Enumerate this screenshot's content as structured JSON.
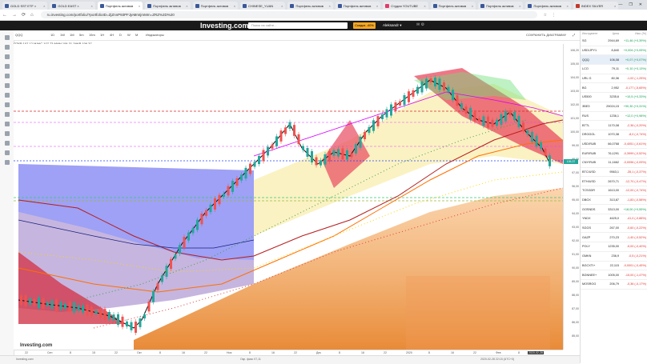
{
  "browser": {
    "tabs": [
      "GOLD SST ETF ×",
      "GOLD EAST ×",
      "Портфель активов",
      "Портфель активов",
      "Портфель активов",
      "CHINESE_YUAN",
      "Портфель активов",
      "Портфель активов",
      "Студия YOUTUBE",
      "Портфель активов",
      "Портфель активов",
      "Портфель активов",
      "INDEX SILVER"
    ],
    "tab_close": "×",
    "url": "ru.investing.com/portfolio/?portfolioID=ZjZnnP93PFJjeMmtjmMm=ZRZ%2D%20",
    "window": {
      "minimize": "—",
      "maximize": "❐",
      "close": "✕"
    },
    "nav": {
      "back": "←",
      "forward": "→",
      "reload": "⟳",
      "home": "⌂"
    },
    "ext_icons": [
      "☆",
      "⋮"
    ]
  },
  "site": {
    "logo": "Investing.com",
    "search_placeholder": "Поиск на сайте...",
    "promo": "Скидка -40%",
    "profile": "Aleksandr ▾",
    "header_icons": "✉ ⚙"
  },
  "chart": {
    "symbol": "QQQ",
    "toolbar": [
      "1D",
      "1W",
      "1M",
      "5m",
      "15m",
      "1H",
      "4H",
      "D",
      "W",
      "M",
      "Индикаторы",
      "⤢"
    ],
    "ohlc": "ОТКР 107,12   МАКС 107,73   МИН 106,31   ЗАКР 106,37",
    "save_label": "СОХРАНИТЬ ДИАГРАММУ",
    "price_labels": [
      "106,20",
      "105,00",
      "104,00",
      "103,00",
      "102,00",
      "101,00",
      "100,00",
      "99,00",
      "98,00",
      "97,00",
      "96,00",
      "95,00",
      "94,00",
      "93,00",
      "92,00",
      "91,00",
      "90,00",
      "89,00",
      "88,00",
      "87,00",
      "86,00",
      "85,00"
    ],
    "last_price": "106,37",
    "date_labels": [
      "22",
      "Сен",
      "8",
      "15",
      "22",
      "Окт",
      "8",
      "16",
      "22",
      "Ноя",
      "8",
      "16",
      "22",
      "Дек",
      "8",
      "16",
      "22",
      "2020",
      "8",
      "16",
      "22",
      "Фев",
      "8",
      "16"
    ],
    "crosshair_date": "2020-02-28",
    "watermark": "Investing.com"
  },
  "watchlist": {
    "headers": [
      "Инструмент",
      "Цена",
      "Изм. (%)"
    ],
    "rows": [
      {
        "sym": "SG",
        "price": "2944,69",
        "chg": "+11,46 (+0,39%)",
        "dir": "pos"
      },
      {
        "sym": "USD/JPY1",
        "price": "8,840",
        "chg": "+0,004 (+0,05%)",
        "dir": "pos"
      },
      {
        "sym": "QQQ",
        "price": "106,08",
        "chg": "+0,07 (+0,07%)",
        "dir": "pos"
      },
      {
        "sym": "LCO",
        "price": "79,11",
        "chg": "+0,10 (+0,13%)",
        "dir": "pos"
      },
      {
        "sym": "URL G",
        "price": "80,36",
        "chg": "-1,02 (-1,25%)",
        "dir": "neg"
      },
      {
        "sym": "BG",
        "price": "2,952",
        "chg": "-0,177 (-5,65%)",
        "dir": "neg"
      },
      {
        "sym": "US500",
        "price": "3235,6",
        "chg": "+10,5 (+0,33%)",
        "dir": "pos"
      },
      {
        "sym": "ЗВЕЗ",
        "price": "29024,15",
        "chg": "+90,30 (+0,31%)",
        "dir": "pos"
      },
      {
        "sym": "RUS",
        "price": "1236,1",
        "chg": "+12,0 (+0,98%)",
        "dir": "pos"
      },
      {
        "sym": "BTTL",
        "price": "1170,08",
        "chg": "-2,36 (-0,20%)",
        "dir": "neg"
      },
      {
        "sym": "DROGOL",
        "price": "1070,38",
        "chg": "-8,0 (-0,74%)",
        "dir": "neg"
      },
      {
        "sym": "USD/RUB",
        "price": "66,0768",
        "chg": "-0,4051 (-0,61%)",
        "dir": "neg"
      },
      {
        "sym": "EUR/RUB",
        "price": "76,1291",
        "chg": "-0,3999 (-0,52%)",
        "dir": "neg"
      },
      {
        "sym": "CNY/RUB",
        "price": "11,1662",
        "chg": "-0,0096 (-0,09%)",
        "dir": "neg"
      },
      {
        "sym": "BTC/USD",
        "price": "9563,1",
        "chg": "-35,1 (-0,37%)",
        "dir": "neg"
      },
      {
        "sym": "ETH/USD",
        "price": "2670,71",
        "chg": "-12,70 (-0,47%)",
        "dir": "neg"
      },
      {
        "sym": "TCSGDR",
        "price": "1613,00",
        "chg": "-12,00 (-0,74%)",
        "dir": "neg"
      },
      {
        "sym": "DBGX",
        "price": "313,87",
        "chg": "-1,83 (-0,58%)",
        "dir": "neg"
      },
      {
        "sym": "GOSNDS",
        "price": "3313,00",
        "chg": "+18,00 (+0,55%)",
        "dir": "pos"
      },
      {
        "sym": "YNDX",
        "price": "4625,0",
        "chg": "-41,0 (-0,88%)",
        "dir": "neg"
      },
      {
        "sym": "SGGS",
        "price": "267,00",
        "chg": "-0,60 (-0,22%)",
        "dir": "neg"
      },
      {
        "sym": "GAZP",
        "price": "270,23",
        "chg": "-1,40 (-0,52%)",
        "dir": "neg"
      },
      {
        "sym": "POLY",
        "price": "1235,00",
        "chg": "-5,00 (-0,40%)",
        "dir": "neg"
      },
      {
        "sym": "GMKN",
        "price": "236,9",
        "chg": "-0,5 (-0,21%)",
        "dir": "neg"
      },
      {
        "sym": "BGCXTI+",
        "price": "22,115",
        "chg": "-0,0001 (-0,45%)",
        "dir": "neg"
      },
      {
        "sym": "BGNNEE+",
        "price": "1005,00",
        "chg": "-15,00 (-1,47%)",
        "dir": "neg"
      },
      {
        "sym": "MOSROG",
        "price": "206,79",
        "chg": "-0,36 (-0,17%)",
        "dir": "neg"
      }
    ]
  },
  "footer": {
    "left": "Investing.com",
    "mid": "Окр. фикс 07,11",
    "right": "2020-02-28 22:15 (UTC+3)"
  },
  "colors": {
    "up": "#26a69a",
    "down": "#ef5350",
    "accent": "#f4a623",
    "header_bg": "#1a1a1a"
  }
}
